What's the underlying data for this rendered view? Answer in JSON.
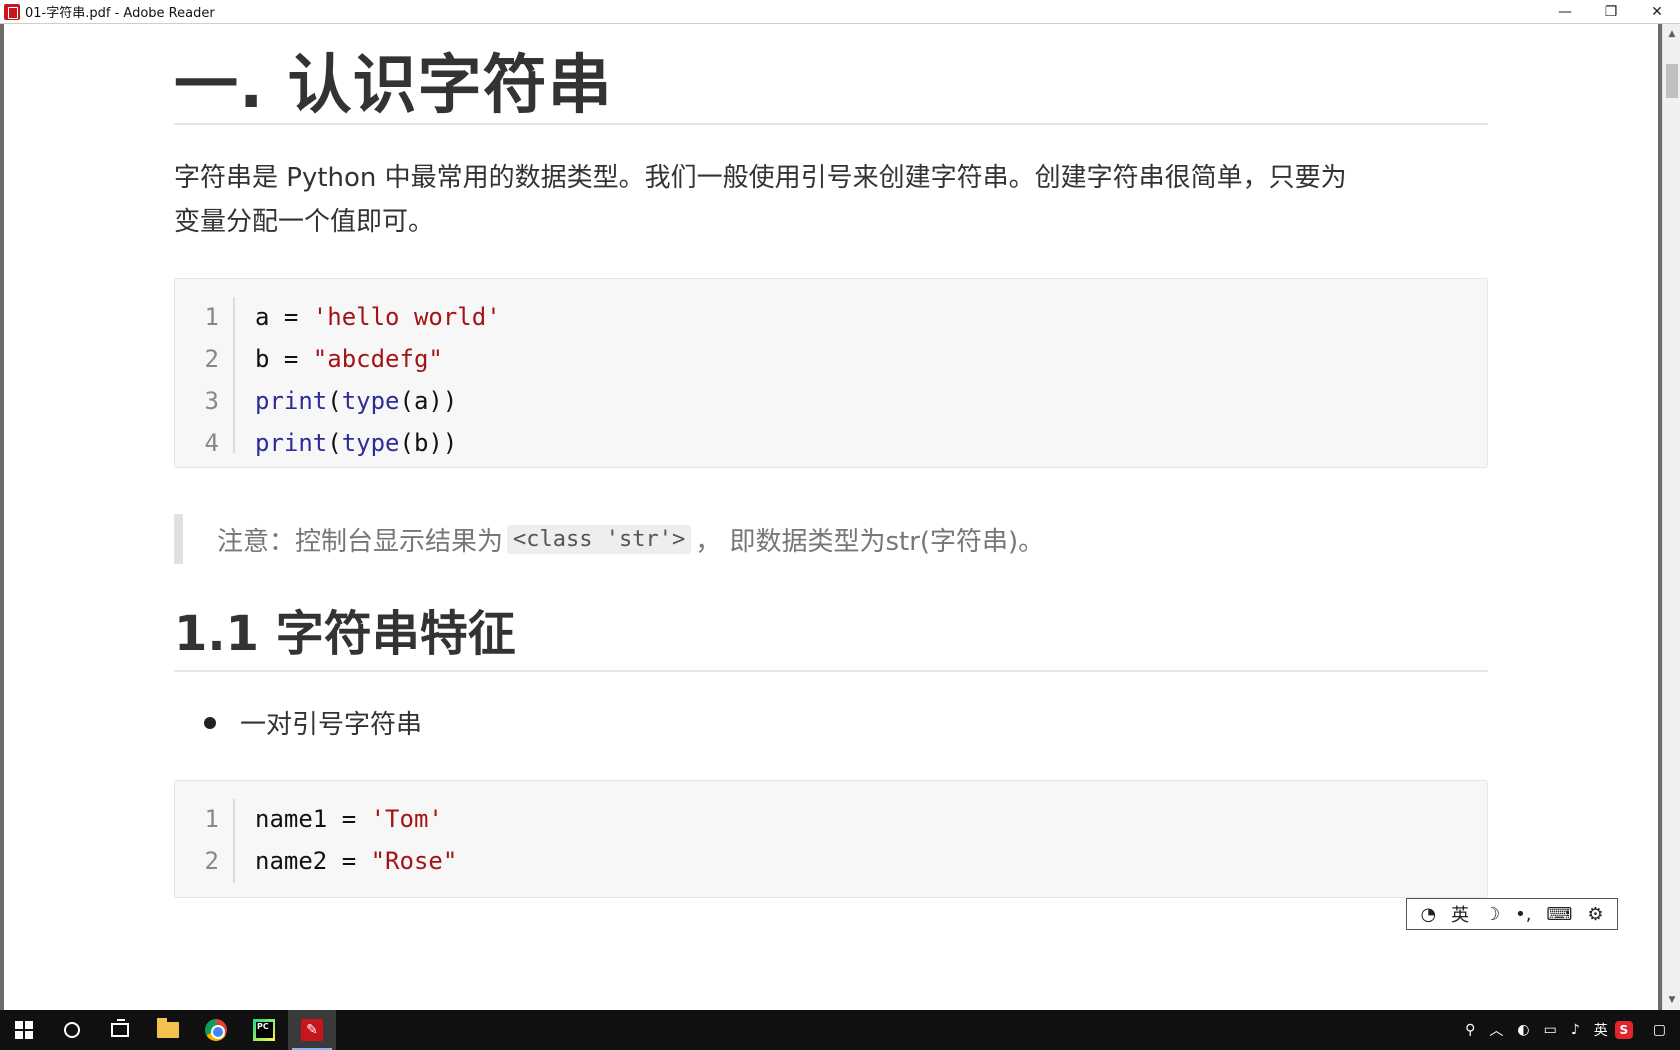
{
  "window": {
    "title": "01-字符串.pdf - Adobe Reader",
    "controls": {
      "minimize": "—",
      "restore": "❐",
      "close": "✕"
    }
  },
  "doc": {
    "heading": "一. 认识字符串",
    "paragraph_line1": "字符串是 Python 中最常用的数据类型。我们一般使用引号来创建字符串。创建字符串很简单，只要为",
    "paragraph_line2": "变量分配一个值即可。",
    "code1": [
      {
        "ln": "1",
        "pre": "a = ",
        "str": "'hello world'"
      },
      {
        "ln": "2",
        "pre": "b = ",
        "str": "\"abcdefg\""
      },
      {
        "ln": "3",
        "kw1": "print",
        "p1": "(",
        "kw2": "type",
        "p2": "(a))"
      },
      {
        "ln": "4",
        "kw1": "print",
        "p1": "(",
        "kw2": "type",
        "p2": "(b))"
      }
    ],
    "note_prefix": "注意：控制台显示结果为",
    "note_code": "<class 'str'>",
    "note_suffix": "，  即数据类型为str(字符串)。",
    "subheading": "1.1 字符串特征",
    "bullet": "一对引号字符串",
    "code2": [
      {
        "ln": "1",
        "pre": "name1 = ",
        "str": "'Tom'"
      },
      {
        "ln": "2",
        "pre": "name2 = ",
        "str": "\"Rose\""
      }
    ]
  },
  "ime": {
    "lang": "英",
    "moon": "☽",
    "punct": "•,",
    "keyboard": "⌨",
    "settings": "⚙"
  },
  "tray": {
    "lang": "英",
    "sogou": "S"
  },
  "colors": {
    "string": "#a31515",
    "keyword": "#2d2d9a",
    "heading": "#333333"
  }
}
